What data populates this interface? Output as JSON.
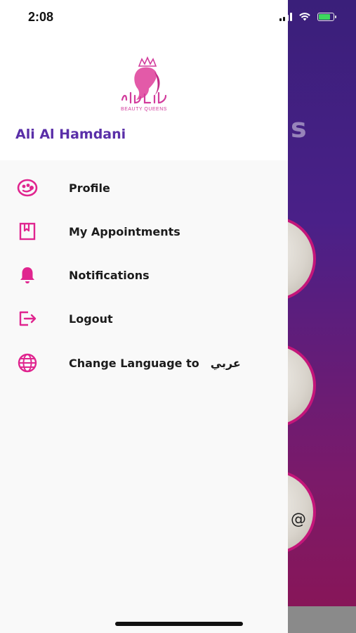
{
  "status_bar": {
    "time": "2:08"
  },
  "background": {
    "title_fragment": "s",
    "at_symbol": "@"
  },
  "drawer": {
    "logo_caption": "BEAUTY QUEENS",
    "user_name": "Ali Al Hamdani",
    "menu": [
      {
        "label": "Profile",
        "icon": "profile-face-icon"
      },
      {
        "label": "My Appointments",
        "icon": "bookmark-icon"
      },
      {
        "label": "Notifications",
        "icon": "bell-icon"
      },
      {
        "label": "Logout",
        "icon": "logout-icon"
      },
      {
        "label": "Change Language to",
        "label_suffix": "عربي",
        "icon": "globe-icon"
      }
    ]
  },
  "colors": {
    "accent": "#e0258f",
    "user_name": "#5a2fa8",
    "bg_gradient_top": "#3a1f7a",
    "bg_gradient_bottom": "#8a1555"
  }
}
